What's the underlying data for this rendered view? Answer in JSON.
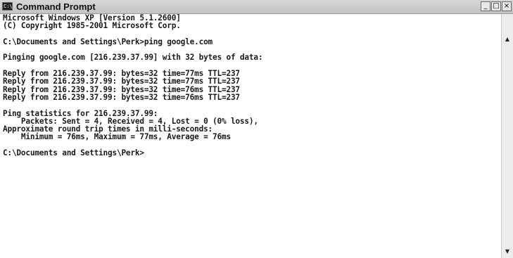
{
  "window": {
    "title": "Command Prompt",
    "icon": "cmd-icon",
    "controls": {
      "minimize": "_",
      "maximize": "□",
      "close": "×"
    }
  },
  "console": {
    "lines": [
      "Microsoft Windows XP [Version 5.1.2600]",
      "(C) Copyright 1985-2001 Microsoft Corp.",
      "",
      "C:\\Documents and Settings\\Perk>ping google.com",
      "",
      "Pinging google.com [216.239.37.99] with 32 bytes of data:",
      "",
      "Reply from 216.239.37.99: bytes=32 time=77ms TTL=237",
      "Reply from 216.239.37.99: bytes=32 time=77ms TTL=237",
      "Reply from 216.239.37.99: bytes=32 time=76ms TTL=237",
      "Reply from 216.239.37.99: bytes=32 time=76ms TTL=237",
      "",
      "Ping statistics for 216.239.37.99:",
      "    Packets: Sent = 4, Received = 4, Lost = 0 (0% loss),",
      "Approximate round trip times in milli-seconds:",
      "    Minimum = 76ms, Maximum = 77ms, Average = 76ms",
      "",
      "C:\\Documents and Settings\\Perk>"
    ]
  },
  "scrollbar": {
    "up_arrow": "▲",
    "down_arrow": "▼"
  }
}
